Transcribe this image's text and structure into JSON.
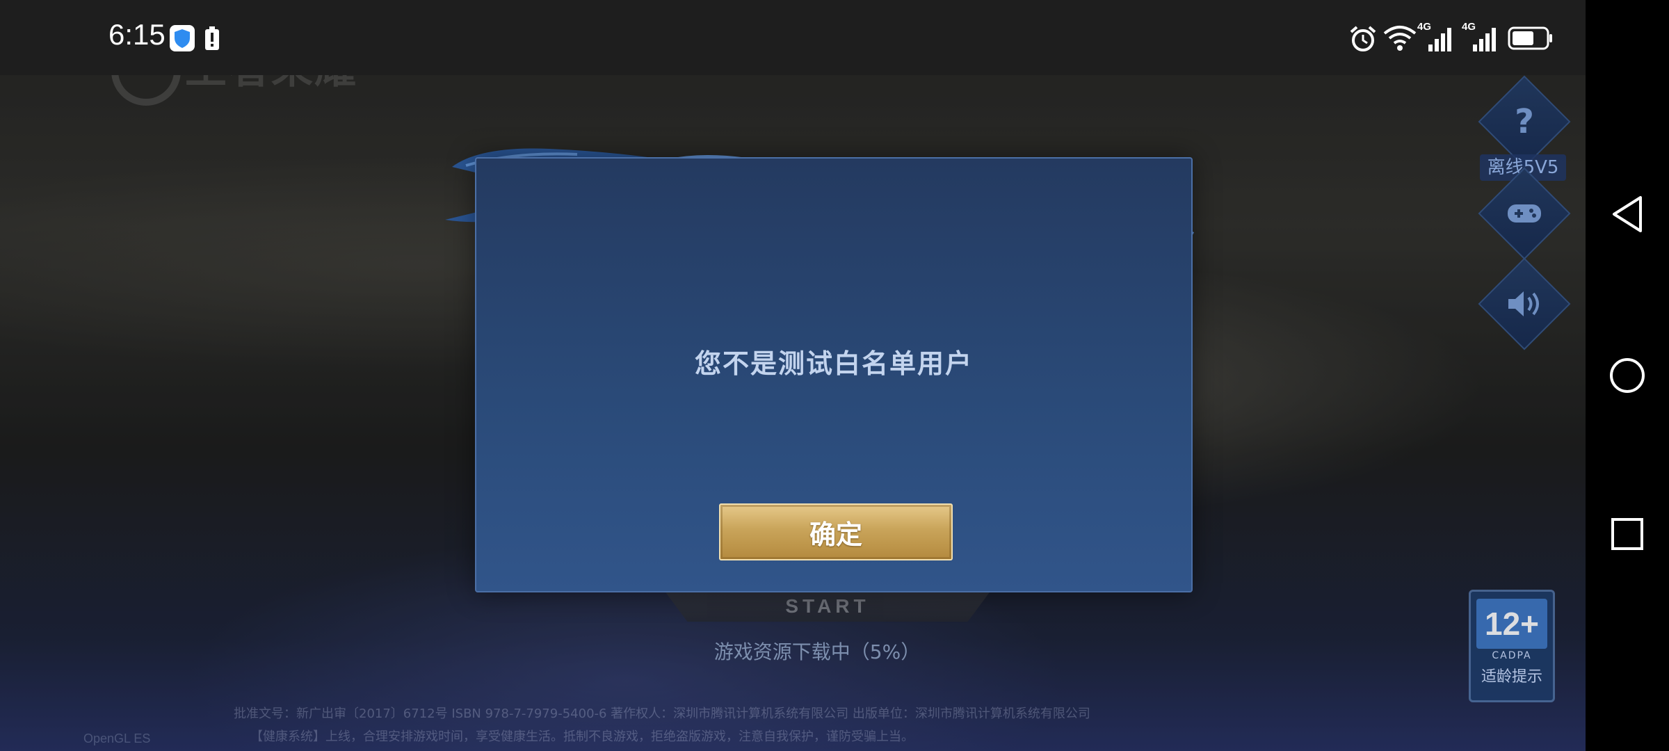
{
  "status_bar": {
    "time": "6:15",
    "network_1": "4G",
    "network_2": "4G"
  },
  "background_logo": "王者荣耀",
  "side_buttons": {
    "help_glyph": "?",
    "offline_mode_label": "离线5V5"
  },
  "age_rating": {
    "age": "12+",
    "org": "CADPA",
    "hint": "适龄提示"
  },
  "start_button": {
    "label": "START"
  },
  "download_status": "游戏资源下载中（5%）",
  "footer": {
    "line_1": "批准文号：新广出审〔2017〕6712号  ISBN 978-7-7979-5400-6  著作权人：深圳市腾讯计算机系统有限公司  出版单位：深圳市腾讯计算机系统有限公司",
    "line_2": "【健康系统】上线，合理安排游戏时间，享受健康生活。抵制不良游戏，拒绝盗版游戏，注意自我保护，谨防受骗上当。",
    "engine": "OpenGL ES"
  },
  "dialog": {
    "message": "您不是测试白名单用户",
    "confirm_label": "确定"
  },
  "colors": {
    "dialog_bg": "#2a4a78",
    "dialog_border": "#4b6fa6",
    "confirm_gold": "#c9a45a",
    "navbar": "#000000"
  }
}
